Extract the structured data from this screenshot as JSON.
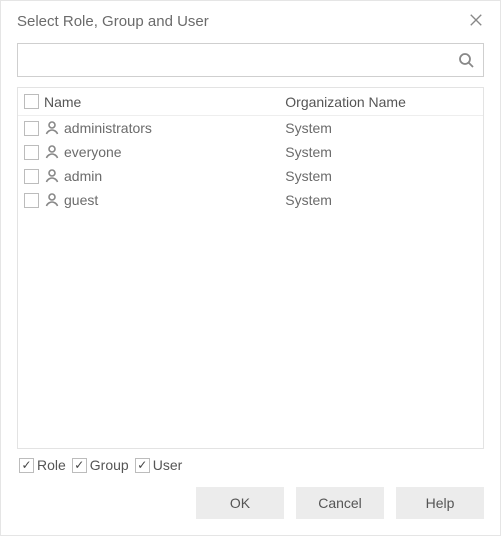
{
  "dialog": {
    "title": "Select Role, Group and User"
  },
  "search": {
    "placeholder": "",
    "value": ""
  },
  "table": {
    "headers": {
      "name": "Name",
      "org": "Organization Name"
    },
    "rows": [
      {
        "checked": false,
        "name": "administrators",
        "org": "System"
      },
      {
        "checked": false,
        "name": "everyone",
        "org": "System"
      },
      {
        "checked": false,
        "name": "admin",
        "org": "System"
      },
      {
        "checked": false,
        "name": "guest",
        "org": "System"
      }
    ]
  },
  "filters": {
    "role": {
      "label": "Role",
      "checked": true
    },
    "group": {
      "label": "Group",
      "checked": true
    },
    "user": {
      "label": "User",
      "checked": true
    }
  },
  "buttons": {
    "ok": "OK",
    "cancel": "Cancel",
    "help": "Help"
  }
}
